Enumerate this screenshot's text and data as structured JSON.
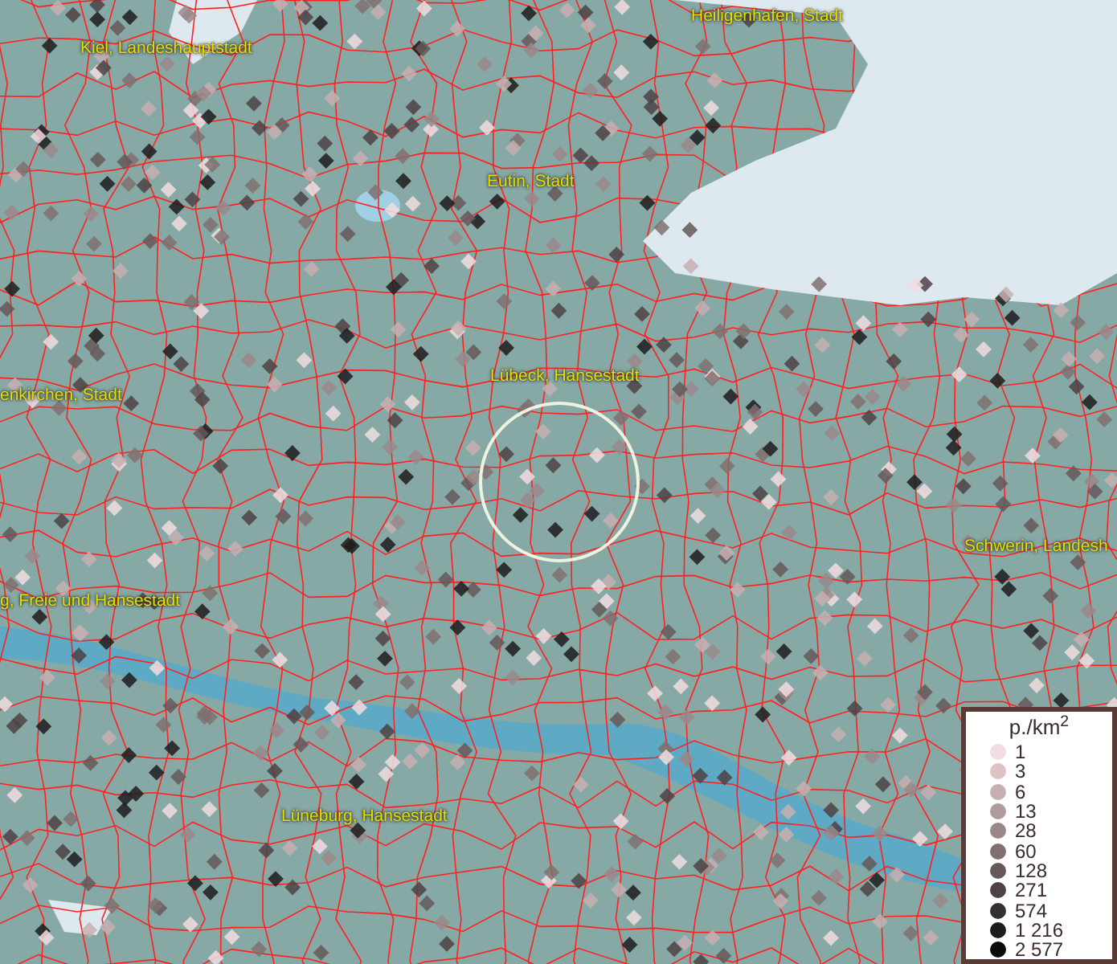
{
  "map": {
    "place_labels": [
      {
        "text": "Heiligenhafen, Stadt"
      },
      {
        "text": "Kiel, Landeshauptstadt"
      },
      {
        "text": "Eutin, Stadt"
      },
      {
        "text": "enkirchen, Stadt"
      },
      {
        "text": "Lübeck, Hansestadt"
      },
      {
        "text": "Schwerin, Landesh"
      },
      {
        "text": "g, Freie und Hansestadt"
      },
      {
        "text": "Lüneburg, Hansestadt"
      }
    ]
  },
  "legend": {
    "title": "p./km$^{2}$",
    "items": [
      {
        "label": "1",
        "color": "#f2dde0"
      },
      {
        "label": "3",
        "color": "#dcc4c6"
      },
      {
        "label": "6",
        "color": "#c7b0b2"
      },
      {
        "label": "13",
        "color": "#b09c9e"
      },
      {
        "label": "28",
        "color": "#9a8889"
      },
      {
        "label": "60",
        "color": "#807070"
      },
      {
        "label": "128",
        "color": "#665858"
      },
      {
        "label": "271",
        "color": "#4d4244"
      },
      {
        "label": "574",
        "color": "#353030"
      },
      {
        "label": "1 216",
        "color": "#1f1c1c"
      },
      {
        "label": "2 577",
        "color": "#0a0a0a"
      }
    ]
  }
}
